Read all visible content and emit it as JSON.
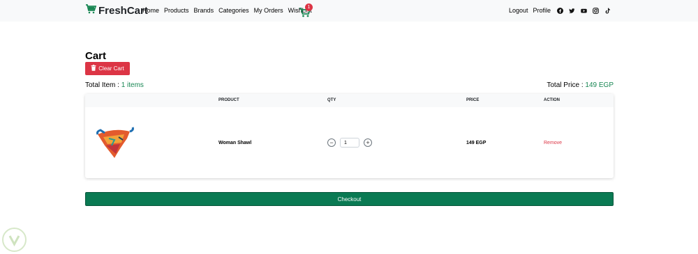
{
  "navbar": {
    "brand": "FreshCart",
    "links": [
      "Home",
      "Products",
      "Brands",
      "Categories",
      "My Orders",
      "WishList"
    ],
    "cart_count": "1",
    "logout": "Logout",
    "profile": "Profile",
    "social_icons": [
      "facebook-icon",
      "twitter-icon",
      "youtube-icon",
      "instagram-icon",
      "tiktok-icon"
    ]
  },
  "page": {
    "title": "Cart",
    "clear_label": "Clear Cart",
    "total_item_label": "Total Item : ",
    "total_item_value": "1 items",
    "total_price_label": "Total Price : ",
    "total_price_value": "149 EGP"
  },
  "table": {
    "headers": [
      "PRODUCT",
      "QTY",
      "PRICE",
      "ACTION"
    ],
    "rows": [
      {
        "name": "Woman Shawl",
        "qty": "1",
        "price": "149 EGP",
        "action": "Remove"
      }
    ]
  },
  "checkout_label": "Checkout",
  "colors": {
    "brand_green": "#198754",
    "danger": "#dc3545",
    "checkout": "#0a7a53"
  }
}
